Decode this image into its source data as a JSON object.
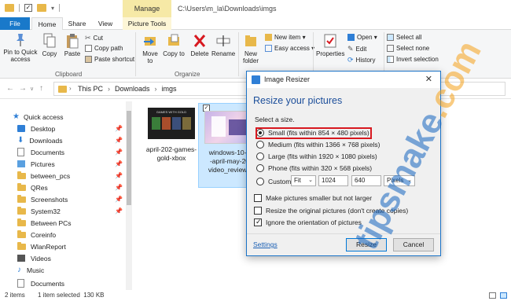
{
  "titlebar": {
    "path_title": "C:\\Users\\m_la\\Downloads\\imgs",
    "manage_label": "Manage"
  },
  "tabs": {
    "file": "File",
    "home": "Home",
    "share": "Share",
    "view": "View",
    "picture_tools": "Picture Tools"
  },
  "ribbon": {
    "pin_quick_access": "Pin to Quick access",
    "copy": "Copy",
    "paste": "Paste",
    "cut": "Cut",
    "copy_path": "Copy path",
    "paste_shortcut": "Paste shortcut",
    "clipboard_group": "Clipboard",
    "move_to": "Move to",
    "copy_to": "Copy to",
    "delete": "Delete",
    "rename": "Rename",
    "organize_group": "Organize",
    "new_folder": "New folder",
    "new_item": "New item ▾",
    "easy_access": "Easy access ▾",
    "properties": "Properties",
    "open": "Open ▾",
    "edit": "Edit",
    "history": "History",
    "select_all": "Select all",
    "select_none": "Select none",
    "invert_selection": "Invert selection"
  },
  "address": {
    "crumbs": [
      "This PC",
      "Downloads",
      "imgs"
    ]
  },
  "navpane": {
    "items": [
      {
        "label": "Quick access",
        "icon": "star-icon",
        "pinned": false
      },
      {
        "label": "Desktop",
        "icon": "desktop-icon",
        "pinned": true
      },
      {
        "label": "Downloads",
        "icon": "download-icon",
        "pinned": true
      },
      {
        "label": "Documents",
        "icon": "document-icon",
        "pinned": true
      },
      {
        "label": "Pictures",
        "icon": "pictures-icon",
        "pinned": true
      },
      {
        "label": "between_pcs",
        "icon": "folder-icon",
        "pinned": true
      },
      {
        "label": "QRes",
        "icon": "folder-icon",
        "pinned": true
      },
      {
        "label": "Screenshots",
        "icon": "folder-icon",
        "pinned": true
      },
      {
        "label": "System32",
        "icon": "folder-icon",
        "pinned": true
      },
      {
        "label": "Between PCs",
        "icon": "folder-icon",
        "pinned": false
      },
      {
        "label": "Coreinfo",
        "icon": "folder-icon",
        "pinned": false
      },
      {
        "label": "WlanReport",
        "icon": "folder-icon",
        "pinned": false
      },
      {
        "label": "Videos",
        "icon": "videos-icon",
        "pinned": false
      },
      {
        "label": "Music",
        "icon": "music-icon",
        "pinned": false
      },
      {
        "label": "Documents",
        "icon": "document-icon",
        "pinned": false
      }
    ]
  },
  "files": [
    {
      "name": "april-202-games-gold-xbox",
      "line1": "april-202-games-",
      "line2": "gold-xbox",
      "thumb_header": "GAMES WITH GOLD"
    },
    {
      "name": "windows-10-2020-april-may-2020-video_review",
      "line1": "windows-10-2",
      "line2": "-april-may-20",
      "line3": "video_review_"
    }
  ],
  "status": {
    "items": "2 items",
    "selected": "1 item selected  130 KB"
  },
  "dialog": {
    "title": "Image Resizer",
    "heading": "Resize your pictures",
    "select_size": "Select a size.",
    "options": [
      {
        "label": "Small (fits within 854 × 480 pixels)",
        "selected": true
      },
      {
        "label": "Medium (fits within 1366 × 768 pixels)",
        "selected": false
      },
      {
        "label": "Large (fits within 1920 × 1080 pixels)",
        "selected": false
      },
      {
        "label": "Phone (fits within 320 × 568 pixels)",
        "selected": false
      },
      {
        "label": "Custom",
        "selected": false
      }
    ],
    "custom_fit": "Fit",
    "custom_width": "1024",
    "custom_height": "640",
    "custom_unit": "Pixels",
    "checkboxes": [
      {
        "label": "Make pictures smaller but not larger",
        "checked": false
      },
      {
        "label": "Resize the original pictures (don't create copies)",
        "checked": false
      },
      {
        "label": "Ignore the orientation of pictures",
        "checked": true
      }
    ],
    "settings_link": "Settings",
    "resize_button": "Resize",
    "cancel_button": "Cancel"
  },
  "watermark": {
    "text": "tipsmake.com"
  },
  "colors": {
    "accent": "#1979ca",
    "manage": "#f6e9a6",
    "highlight": "#d71920",
    "heading": "#1c4e9a",
    "watermark_blue": "#1565c0",
    "watermark_orange": "#f5a21b"
  }
}
